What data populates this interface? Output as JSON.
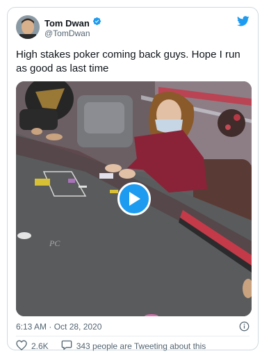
{
  "author": {
    "name": "Tom Dwan",
    "handle": "@TomDwan",
    "verified": true
  },
  "tweet": {
    "text": "High stakes poker coming back guys. Hope I run as good as last time",
    "timestamp": "6:13 AM · Oct 28, 2020"
  },
  "media": {
    "type": "video",
    "play_icon": "play-icon"
  },
  "actions": {
    "like_count": "2.6K",
    "reply_text": "343 people are Tweeting about this"
  },
  "colors": {
    "brand": "#1d9bf0",
    "like": "#e0245e",
    "text": "#0f1419",
    "muted": "#536471",
    "border": "#cfd9de"
  },
  "icons": {
    "logo": "twitter-bird-icon",
    "verified": "verified-badge-icon",
    "info": "info-icon",
    "like": "heart-icon",
    "reply": "speech-bubble-icon"
  }
}
